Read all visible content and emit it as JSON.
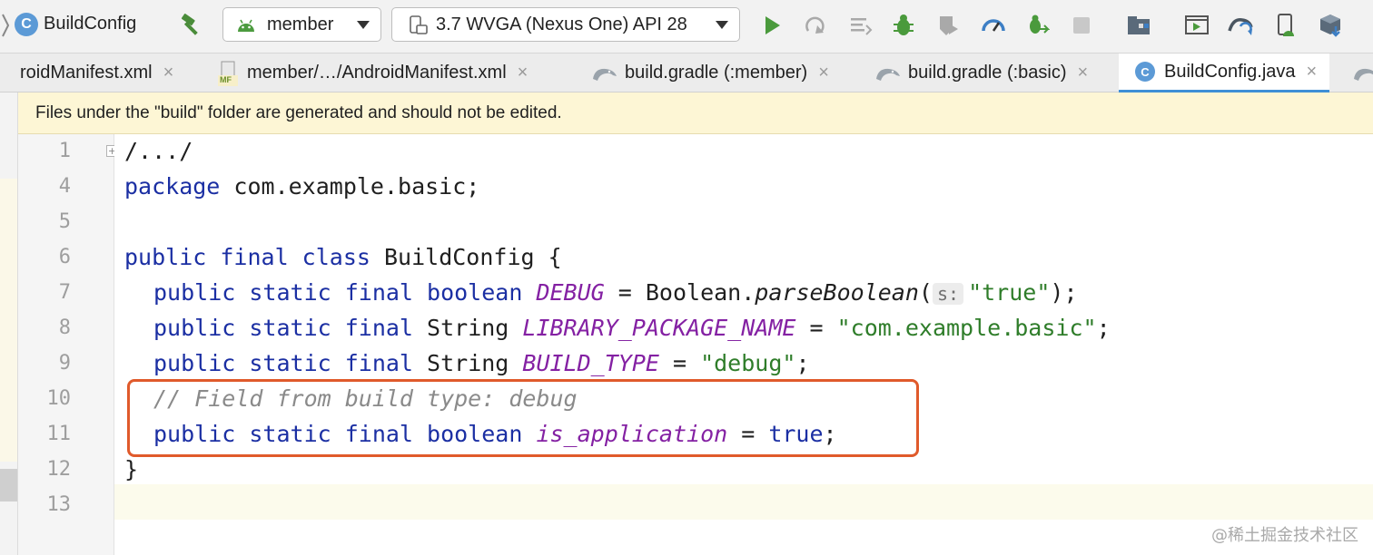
{
  "breadcrumb": {
    "file_icon_letter": "C",
    "title": "BuildConfig"
  },
  "toolbar": {
    "run_config": "member",
    "device": "3.7  WVGA (Nexus One) API 28",
    "icons": [
      "hammer-icon",
      "run-icon",
      "apply-changes-icon",
      "apply-code-changes-icon",
      "debug-icon",
      "coverage-icon",
      "profile-icon",
      "attach-debugger-icon",
      "stop-icon",
      "project-structure-icon",
      "avd-manager-icon",
      "sync-gradle-icon",
      "device-manager-icon",
      "sdk-manager-icon"
    ]
  },
  "tabs": [
    {
      "label": "roidManifest.xml",
      "icon": "none"
    },
    {
      "label": "member/…/AndroidManifest.xml",
      "icon": "manifest-icon",
      "icon_text": "MF"
    },
    {
      "label": "build.gradle (:member)",
      "icon": "gradle-icon"
    },
    {
      "label": "build.gradle (:basic)",
      "icon": "gradle-icon"
    },
    {
      "label": "BuildConfig.java",
      "icon": "class-icon",
      "icon_text": "C",
      "active": true
    }
  ],
  "tab_close_glyph": "×",
  "notice": "Files under the \"build\" folder are generated and should not be edited.",
  "editor": {
    "line_numbers": [
      "1",
      "4",
      "5",
      "6",
      "7",
      "8",
      "9",
      "10",
      "11",
      "12",
      "13"
    ],
    "code": {
      "l1": "/.../",
      "l4_kw": "package",
      "l4_rest": " com.example.basic;",
      "l6_kw": "public final class",
      "l6_rest": " BuildConfig {",
      "l7_kw": "public static final boolean",
      "l7_field": "DEBUG",
      "l7_mid": " = Boolean.",
      "l7_method": "parseBoolean",
      "l7_paren": "(",
      "l7_hint": "s:",
      "l7_str": "\"true\"",
      "l7_end": ");",
      "l8_kw": "public static final",
      "l8_type": " String ",
      "l8_field": "LIBRARY_PACKAGE_NAME",
      "l8_eq": " = ",
      "l8_str": "\"com.example.basic\"",
      "l8_end": ";",
      "l9_kw": "public static final",
      "l9_type": " String ",
      "l9_field": "BUILD_TYPE",
      "l9_eq": " = ",
      "l9_str": "\"debug\"",
      "l9_end": ";",
      "l10_comment": "// Field from build type: debug",
      "l11_kw": "public static final boolean",
      "l11_field": "is_application",
      "l11_eq": " = ",
      "l11_val": "true",
      "l11_end": ";",
      "l12": "}"
    }
  },
  "watermark": "@稀土掘金技术社区",
  "colors": {
    "keyword": "#1b2fa3",
    "field": "#8421a3",
    "string": "#2f7d2a",
    "comment": "#8a8a8a",
    "highlight_box": "#e05a2b",
    "notice_bg": "#fdf6d5",
    "active_tab_underline": "#3f8fd6"
  }
}
